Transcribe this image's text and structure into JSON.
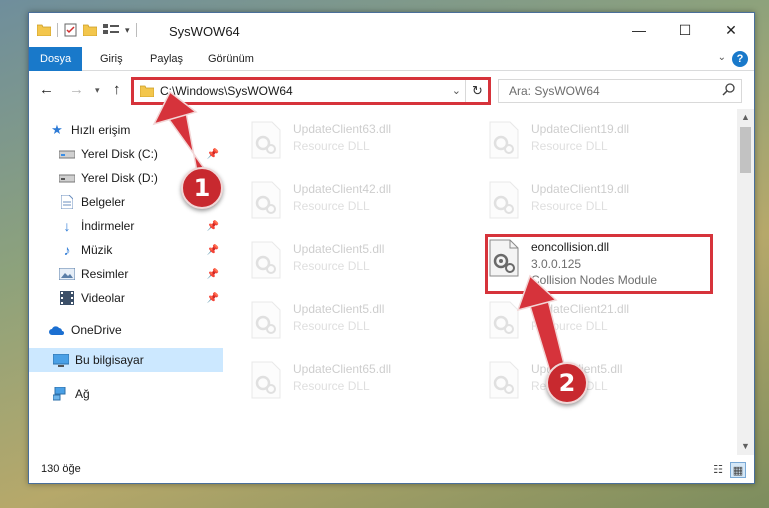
{
  "window": {
    "title": "SysWOW64",
    "controls": [
      "—",
      "☐",
      "✕"
    ]
  },
  "ribbon": {
    "tabs": [
      {
        "label": "Dosya",
        "active": true
      },
      {
        "label": "Giriş"
      },
      {
        "label": "Paylaş"
      },
      {
        "label": "Görünüm"
      }
    ],
    "help": "?"
  },
  "nav": {
    "address_path": "C:\\Windows\\SysWOW64",
    "search_placeholder": "Ara: SysWOW64"
  },
  "sidebar": {
    "items": [
      {
        "label": "Hızlı erişim",
        "icon": "star-icon"
      },
      {
        "label": "Yerel Disk (C:)",
        "icon": "drive-icon",
        "pinned": true
      },
      {
        "label": "Yerel Disk (D:)",
        "icon": "drive-icon",
        "pinned": true
      },
      {
        "label": "Belgeler",
        "icon": "document-icon",
        "pinned": true
      },
      {
        "label": "İndirmeler",
        "icon": "download-icon",
        "pinned": true
      },
      {
        "label": "Müzik",
        "icon": "music-icon",
        "pinned": true
      },
      {
        "label": "Resimler",
        "icon": "pictures-icon",
        "pinned": true
      },
      {
        "label": "Videolar",
        "icon": "video-icon",
        "pinned": true
      },
      {
        "label": "OneDrive",
        "icon": "cloud-icon"
      },
      {
        "label": "Bu bilgisayar",
        "icon": "computer-icon",
        "selected": true
      },
      {
        "label": "Ağ",
        "icon": "network-icon"
      }
    ]
  },
  "files": [
    {
      "name": "UpdateClient63.dll",
      "type": "Resource DLL",
      "faded": true
    },
    {
      "name": "UpdateClient19.dll",
      "type": "Resource DLL",
      "faded": true
    },
    {
      "name": "UpdateClient42.dll",
      "type": "Resource DLL",
      "faded": true
    },
    {
      "name": "UpdateClient19.dll",
      "type": "Resource DLL",
      "faded": true
    },
    {
      "name": "UpdateClient5.dll",
      "type": "Resource DLL",
      "faded": true
    },
    {
      "name": "eoncollision.dll",
      "version": "3.0.0.125",
      "type": "Collision Nodes Module",
      "faded": false
    },
    {
      "name": "UpdateClient5.dll",
      "type": "Resource DLL",
      "faded": true
    },
    {
      "name": "UpdateClient21.dll",
      "type": "Resource DLL",
      "faded": true
    },
    {
      "name": "UpdateClient65.dll",
      "type": "Resource DLL",
      "faded": true
    },
    {
      "name": "UpdateClient5.dll",
      "type": "Resource DLL",
      "faded": true
    }
  ],
  "status": {
    "item_count": "130 öğe"
  },
  "annotations": {
    "step1": "1",
    "step2": "2",
    "highlight_color": "#d6333b"
  }
}
